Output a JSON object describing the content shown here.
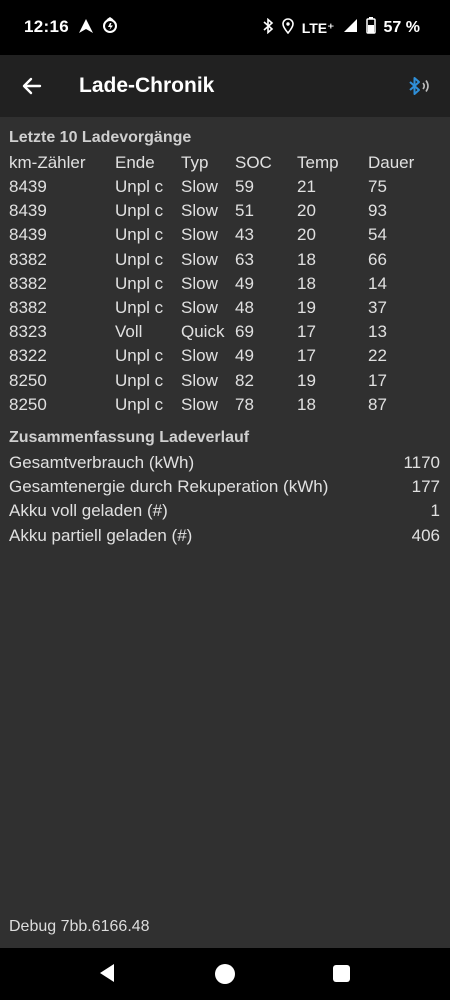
{
  "status_bar": {
    "time": "12:16",
    "network": "LTE⁺",
    "battery": "57 %"
  },
  "app_bar": {
    "title": "Lade-Chronik"
  },
  "history": {
    "title": "Letzte 10 Ladevorgänge",
    "headers": [
      "km-Zähler",
      "Ende",
      "Typ",
      "SOC",
      "Temp",
      "Dauer"
    ],
    "rows": [
      [
        "8439",
        "Unpl c",
        "Slow",
        "59",
        "21",
        "75"
      ],
      [
        "8439",
        "Unpl c",
        "Slow",
        "51",
        "20",
        "93"
      ],
      [
        "8439",
        "Unpl c",
        "Slow",
        "43",
        "20",
        "54"
      ],
      [
        "8382",
        "Unpl c",
        "Slow",
        "63",
        "18",
        "66"
      ],
      [
        "8382",
        "Unpl c",
        "Slow",
        "49",
        "18",
        "14"
      ],
      [
        "8382",
        "Unpl c",
        "Slow",
        "48",
        "19",
        "37"
      ],
      [
        "8323",
        "Voll",
        "Quick",
        "69",
        "17",
        "13"
      ],
      [
        "8322",
        "Unpl c",
        "Slow",
        "49",
        "17",
        "22"
      ],
      [
        "8250",
        "Unpl c",
        "Slow",
        "82",
        "19",
        "17"
      ],
      [
        "8250",
        "Unpl c",
        "Slow",
        "78",
        "18",
        "87"
      ]
    ]
  },
  "summary": {
    "title": "Zusammenfassung Ladeverlauf",
    "items": [
      {
        "label": "Gesamtverbrauch (kWh)",
        "value": "1170"
      },
      {
        "label": "Gesamtenergie durch Rekuperation (kWh)",
        "value": "177"
      },
      {
        "label": "Akku voll geladen (#)",
        "value": "1"
      },
      {
        "label": "Akku partiell geladen (#)",
        "value": "406"
      }
    ]
  },
  "footer": {
    "debug": "Debug 7bb.6166.48"
  },
  "colors": {
    "background": "#303030",
    "appbar": "#212121",
    "bluetooth_accent": "#2f8fd8"
  }
}
